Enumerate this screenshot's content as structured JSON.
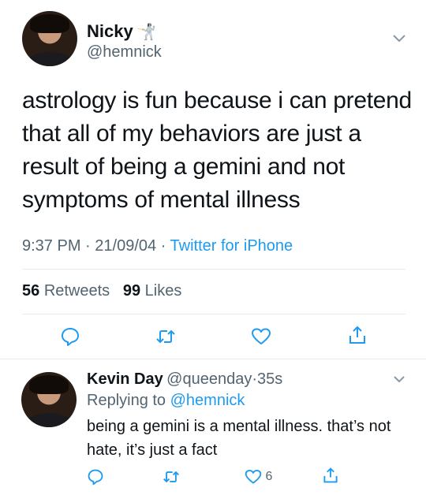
{
  "tweet": {
    "author_name": "Nicky",
    "author_emoji": "🤺",
    "author_handle": "@hemnick",
    "text": "astrology is fun because i can pretend that all of my behaviors are just a result of being a gemini and not symptoms of mental illness",
    "time": "9:37 PM",
    "date": "21/09/04",
    "source": "Twitter for iPhone",
    "retweets_count": "56",
    "retweets_label": "Retweets",
    "likes_count": "99",
    "likes_label": "Likes"
  },
  "reply": {
    "author_name": "Kevin Day",
    "author_handle": "@queenday",
    "age": "35s",
    "replying_label": "Replying to",
    "replying_handle": "@hemnick",
    "text": "being a gemini is a mental illness. that’s not hate, it’s just a fact",
    "like_count": "6"
  },
  "colors": {
    "accent": "#1d9bf0",
    "secondary_text": "#536471",
    "primary_text": "#0f1419",
    "divider": "#e6ecf0"
  },
  "icons": [
    "chevron-down-icon",
    "reply-icon",
    "retweet-icon",
    "like-icon",
    "share-icon"
  ]
}
